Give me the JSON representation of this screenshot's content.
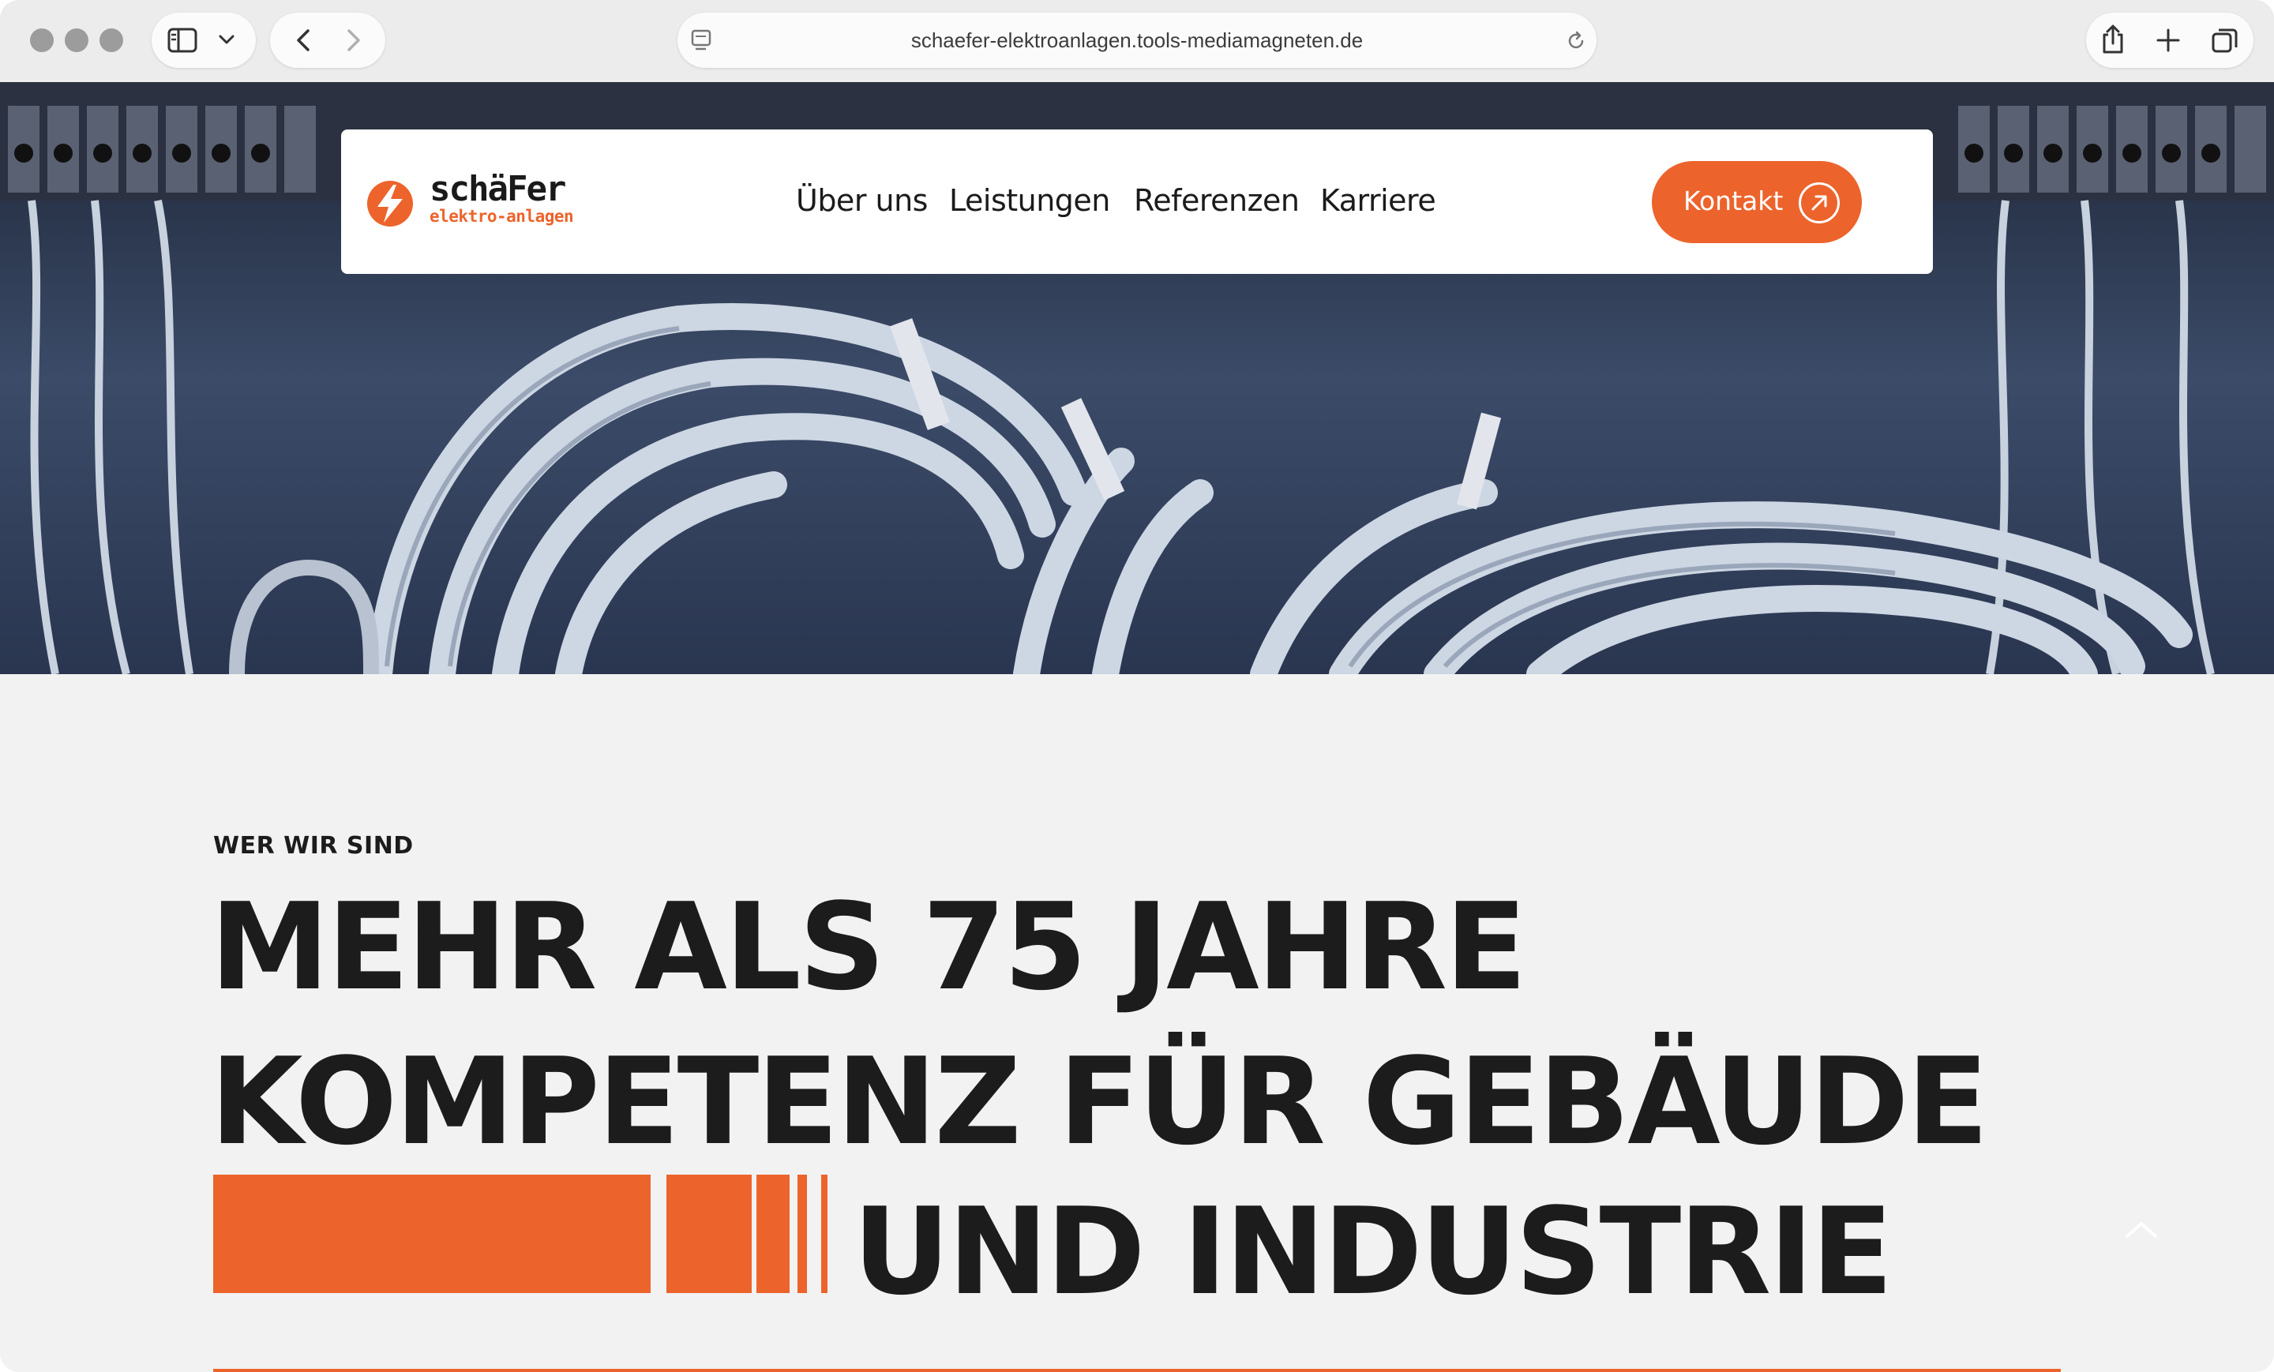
{
  "browser": {
    "url": "schaefer-elektroanlagen.tools-mediamagneten.de"
  },
  "brand": {
    "name": "schäFer",
    "tagline": "elektro-anlagen",
    "accent_color": "#ec642c"
  },
  "nav": {
    "items": [
      {
        "label": "Über uns"
      },
      {
        "label": "Leistungen"
      },
      {
        "label": "Referenzen"
      },
      {
        "label": "Karriere"
      }
    ],
    "cta_label": "Kontakt"
  },
  "intro": {
    "eyebrow": "WER WIR SIND",
    "headline_lines": [
      "MEHR ALS 75 JAHRE",
      "KOMPETENZ FÜR GEBÄUDE",
      "UND INDUSTRIE"
    ]
  }
}
